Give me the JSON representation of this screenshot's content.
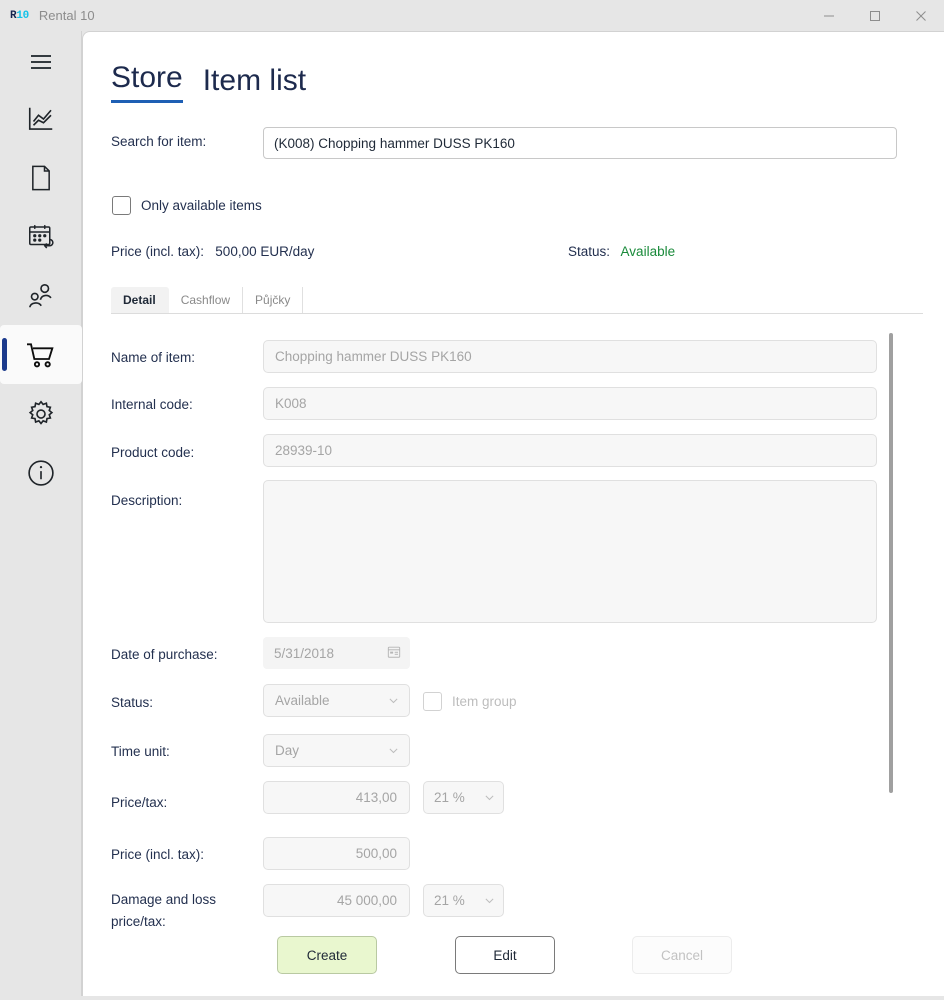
{
  "window": {
    "logo_r": "R",
    "logo_num": "10",
    "title": "Rental 10",
    "minimize": "minimize-icon",
    "maximize": "maximize-icon",
    "close": "close-icon"
  },
  "sidebar": {
    "menu_toggle": "hamburger-icon",
    "items": [
      {
        "icon": "chart-icon",
        "active": false
      },
      {
        "icon": "document-icon",
        "active": false
      },
      {
        "icon": "calendar-return-icon",
        "active": false
      },
      {
        "icon": "people-icon",
        "active": false
      },
      {
        "icon": "shopping-cart-icon",
        "active": true
      },
      {
        "icon": "gear-icon",
        "active": false
      },
      {
        "icon": "info-icon",
        "active": false
      }
    ]
  },
  "page": {
    "tabs": [
      {
        "label": "Store",
        "active": true
      },
      {
        "label": "Item list",
        "active": false
      }
    ]
  },
  "search": {
    "label": "Search for item:",
    "value": "(K008) Chopping hammer DUSS PK160",
    "placeholder": ""
  },
  "filter": {
    "only_available_label": "Only available items",
    "only_available_checked": false
  },
  "summary": {
    "price_label": "Price (incl. tax):",
    "price_value": "500,00 EUR/day",
    "status_label": "Status:",
    "status_value": "Available",
    "status_color": "#198a3a"
  },
  "inner_tabs": [
    {
      "label": "Detail",
      "active": true
    },
    {
      "label": "Cashflow",
      "active": false
    },
    {
      "label": "Půjčky",
      "active": false
    }
  ],
  "detail_form": {
    "name_label": "Name of item:",
    "name_value": "Chopping hammer DUSS PK160",
    "internal_code_label": "Internal code:",
    "internal_code_value": "K008",
    "product_code_label": "Product code:",
    "product_code_value": "28939-10",
    "description_label": "Description:",
    "description_value": "",
    "date_label": "Date of purchase:",
    "date_value": "5/31/2018",
    "date_icon": "calendar-icon",
    "status_label": "Status:",
    "status_value": "Available",
    "item_group_label": "Item group",
    "item_group_checked": false,
    "time_unit_label": "Time unit:",
    "time_unit_value": "Day",
    "price_tax_label": "Price/tax:",
    "price_tax_value": "413,00",
    "price_tax_rate": "21 %",
    "price_incl_label": "Price (incl. tax):",
    "price_incl_value": "500,00",
    "damage_label": "Damage and loss price/tax:",
    "damage_value": "45 000,00",
    "damage_rate": "21 %"
  },
  "actions": {
    "create": "Create",
    "edit": "Edit",
    "cancel": "Cancel"
  }
}
